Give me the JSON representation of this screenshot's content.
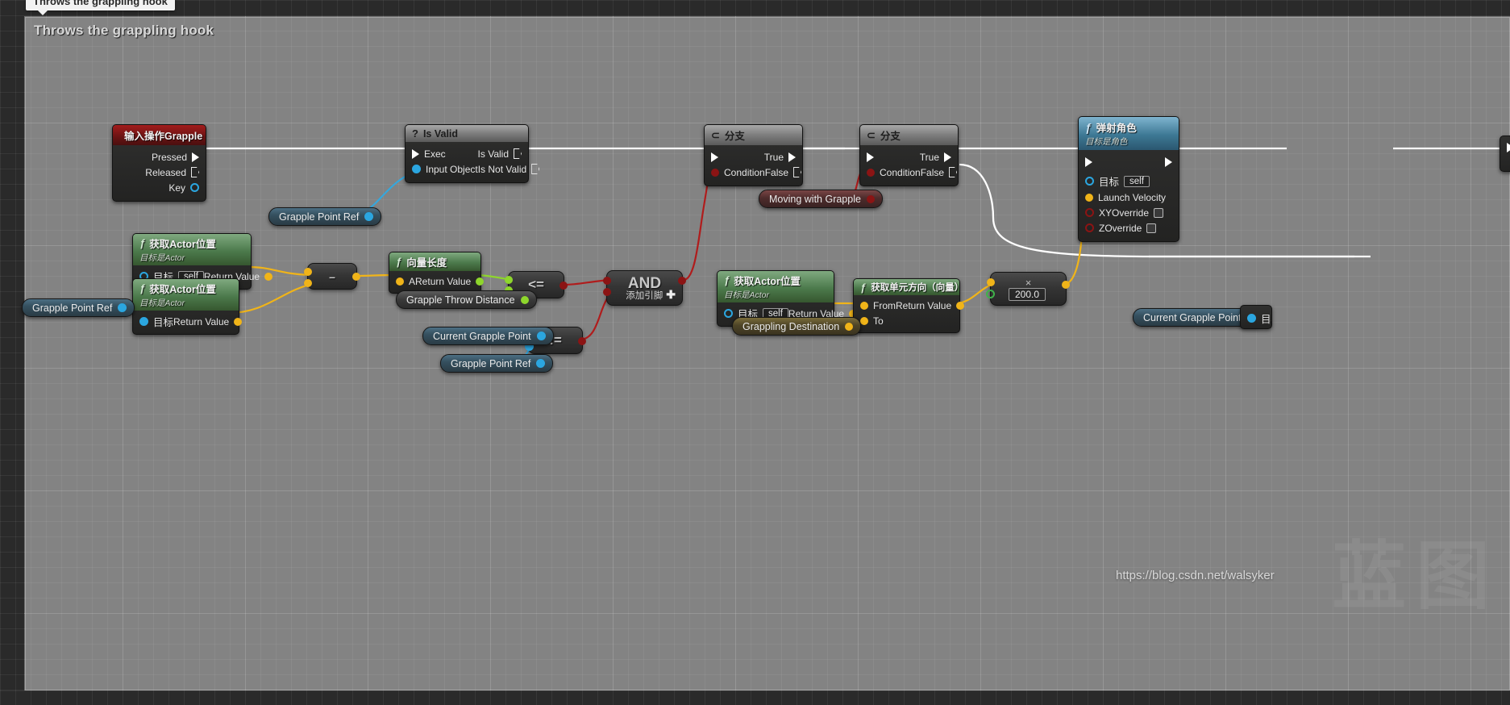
{
  "window": {
    "tooltip_text": "Throws the grappling hook",
    "comment_title": "Throws the grappling hook",
    "watermark_url": "https://blog.csdn.net/walsyker",
    "watermark_logo": "蓝图"
  },
  "colors": {
    "exec_white": "#ffffff",
    "bool_red": "#8b1414",
    "object_blue": "#2ba6e0",
    "vector_yellow": "#f0b419",
    "float_green": "#8ed62c",
    "header_red": "#a31c1c",
    "header_grey": "#a8a8a8",
    "header_green": "#4c7a4c",
    "header_blue": "#3d7894"
  },
  "nodes": {
    "input_action": {
      "title": "输入操作Grapple",
      "icon": "diamond-icon",
      "pins": [
        {
          "label": "Pressed",
          "type": "exec"
        },
        {
          "label": "Released",
          "type": "exec-hollow"
        },
        {
          "label": "Key",
          "type": "object"
        }
      ]
    },
    "is_valid": {
      "title": "Is Valid",
      "icon": "question-icon",
      "in_pins": [
        {
          "label": "Exec",
          "type": "exec"
        },
        {
          "label": "Input Object",
          "type": "object"
        }
      ],
      "out_pins": [
        {
          "label": "Is Valid",
          "type": "exec-hollow"
        },
        {
          "label": "Is Not Valid",
          "type": "exec-hollow"
        }
      ]
    },
    "branch_1": {
      "title": "分支",
      "icon": "branch-icon",
      "in_pins": [
        {
          "label": "",
          "type": "exec"
        },
        {
          "label": "Condition",
          "type": "bool"
        }
      ],
      "out_pins": [
        {
          "label": "True",
          "type": "exec"
        },
        {
          "label": "False",
          "type": "exec-hollow"
        }
      ]
    },
    "branch_2": {
      "title": "分支",
      "icon": "branch-icon",
      "in_pins": [
        {
          "label": "",
          "type": "exec"
        },
        {
          "label": "Condition",
          "type": "bool"
        }
      ],
      "out_pins": [
        {
          "label": "True",
          "type": "exec"
        },
        {
          "label": "False",
          "type": "exec-hollow"
        }
      ]
    },
    "launch_character": {
      "title": "弹射角色",
      "subtitle": "目标是角色",
      "icon": "function-icon",
      "rows": [
        {
          "label": "目标",
          "type": "object",
          "value": "self"
        },
        {
          "label": "Launch Velocity",
          "type": "vector"
        },
        {
          "label": "XYOverride",
          "type": "bool-ring",
          "checkbox": true
        },
        {
          "label": "ZOverride",
          "type": "bool-ring",
          "checkbox": true
        }
      ]
    },
    "get_actor_location_1": {
      "title": "获取Actor位置",
      "subtitle": "目标是Actor",
      "icon": "function-icon",
      "target_label": "目标",
      "target_value": "self",
      "return_label": "Return Value"
    },
    "get_actor_location_2": {
      "title": "获取Actor位置",
      "subtitle": "目标是Actor",
      "icon": "function-icon",
      "target_label": "目标",
      "target_value": "",
      "return_label": "Return Value"
    },
    "get_actor_location_3": {
      "title": "获取Actor位置",
      "subtitle": "目标是Actor",
      "icon": "function-icon",
      "target_label": "目标",
      "target_value": "self",
      "return_label": "Return Value"
    },
    "vector_length": {
      "title": "向量长度",
      "icon": "function-icon",
      "input_label": "A",
      "return_label": "Return Value"
    },
    "get_unit_direction": {
      "title": "获取单元方向（向量）",
      "icon": "function-icon",
      "from_label": "From",
      "to_label": "To",
      "return_label": "Return Value"
    },
    "subtract": {
      "symbol": "–"
    },
    "less_equal": {
      "symbol": "<="
    },
    "not_equal": {
      "symbol": "!="
    },
    "and_node": {
      "symbol": "AND",
      "add_pin_label": "添加引脚",
      "add_pin_icon": "plus-icon"
    },
    "multiply": {
      "symbol": "×",
      "value": "200.0"
    }
  },
  "variables": [
    {
      "name": "grapple-point-ref-left",
      "label": "Grapple Point Ref",
      "pin": "object"
    },
    {
      "name": "grapple-point-ref-mid",
      "label": "Grapple Point Ref",
      "pin": "object"
    },
    {
      "name": "grapple-throw-distance",
      "label": "Grapple Throw Distance",
      "pin": "float"
    },
    {
      "name": "current-grapple-point-1",
      "label": "Current Grapple Point",
      "pin": "object"
    },
    {
      "name": "grapple-point-ref-lower",
      "label": "Grapple Point Ref",
      "pin": "object"
    },
    {
      "name": "moving-with-grapple",
      "label": "Moving with Grapple",
      "pin": "bool"
    },
    {
      "name": "grappling-destination",
      "label": "Grappling Destination",
      "pin": "vector"
    },
    {
      "name": "current-grapple-point-2",
      "label": "Current Grapple Point",
      "pin": "object"
    }
  ],
  "right_edge": {
    "target_label": "目标"
  }
}
